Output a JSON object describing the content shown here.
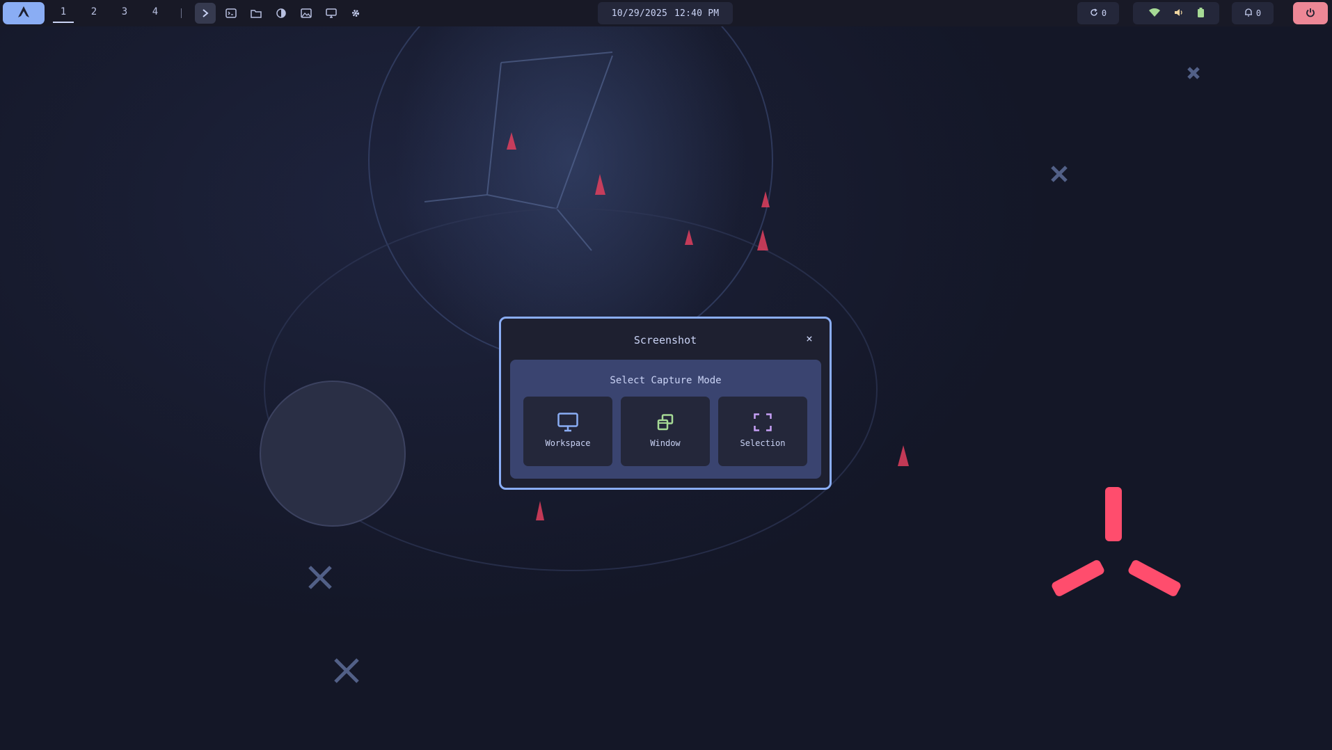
{
  "topbar": {
    "launcher_icon": "arch-logo-icon",
    "workspaces": [
      "1",
      "2",
      "3",
      "4"
    ],
    "active_workspace": "1",
    "quick_icons": [
      "terminal-chevron-icon",
      "terminal-icon",
      "folder-icon",
      "theme-icon",
      "image-icon",
      "display-icon",
      "gear-icon"
    ],
    "date": "10/29/2025",
    "time": "12:40 PM",
    "updates_count": "0",
    "notifications_count": "0",
    "status_icons": [
      "wifi-icon",
      "volume-icon",
      "battery-icon"
    ],
    "colors": {
      "accent": "#8aadf4",
      "power": "#ed8796",
      "wifi": "#a6da95",
      "battery": "#a6da95",
      "volume": "#eed49f"
    }
  },
  "dialog": {
    "title": "Screenshot",
    "close_label": "×",
    "panel_label": "Select Capture Mode",
    "modes": [
      {
        "label": "Workspace",
        "icon": "monitor-icon",
        "color": "#8aadf4"
      },
      {
        "label": "Window",
        "icon": "window-icon",
        "color": "#a6da95"
      },
      {
        "label": "Selection",
        "icon": "selection-icon",
        "color": "#c6a0f6"
      }
    ]
  }
}
